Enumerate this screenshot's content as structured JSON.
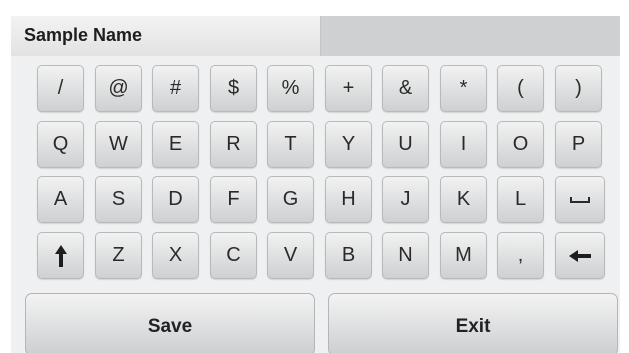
{
  "field": {
    "label": "Sample Name",
    "value": ""
  },
  "keyboard": {
    "row1": [
      "/",
      "@",
      "#",
      "$",
      "%",
      "+",
      "&",
      "*",
      "(",
      ")"
    ],
    "row2": [
      "Q",
      "W",
      "E",
      "R",
      "T",
      "Y",
      "U",
      "I",
      "O",
      "P"
    ],
    "row3": [
      "A",
      "S",
      "D",
      "F",
      "G",
      "H",
      "J",
      "K",
      "L"
    ],
    "row4": [
      "Z",
      "X",
      "C",
      "V",
      "B",
      "N",
      "M",
      ","
    ]
  },
  "icons": {
    "space": "space-bar-icon",
    "shift": "shift-up-arrow-icon",
    "backspace": "backspace-left-arrow-icon"
  },
  "actions": {
    "save_label": "Save",
    "exit_label": "Exit"
  },
  "colors": {
    "background": "#eff0f1",
    "key_face": "#dedfe0",
    "title_bar": "#cfd0d1"
  }
}
